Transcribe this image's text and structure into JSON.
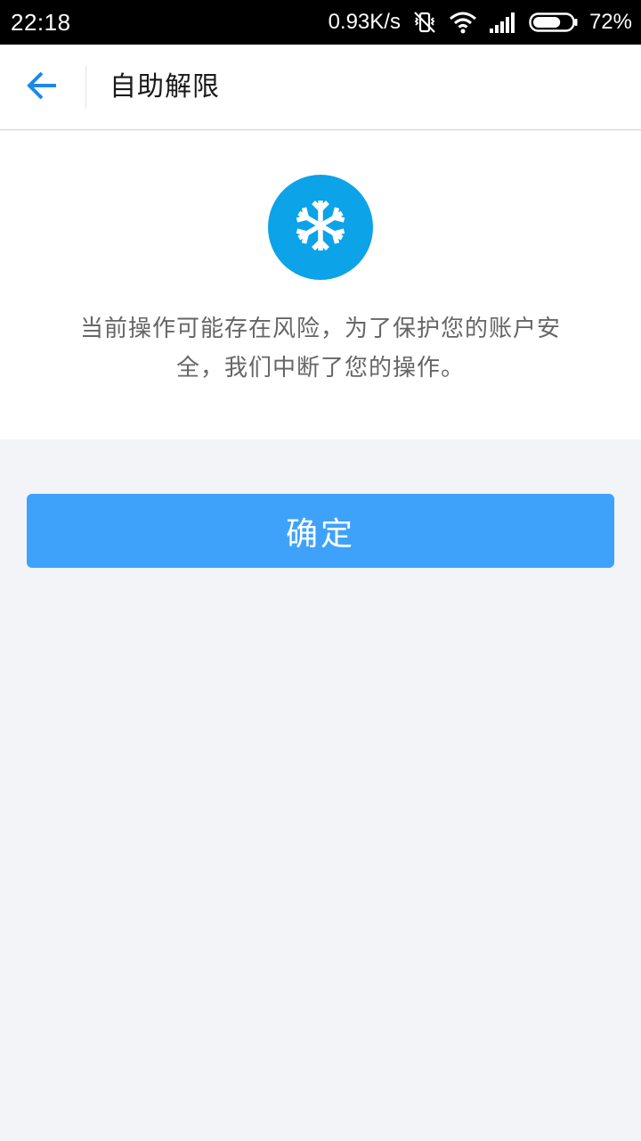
{
  "status_bar": {
    "time": "22:18",
    "network_speed": "0.93K/s",
    "battery_percent": "72%",
    "battery_level": 0.72,
    "icons": [
      "vibrate-off-icon",
      "wifi-icon",
      "signal-icon",
      "battery-icon"
    ]
  },
  "header": {
    "back_icon": "arrow-left-icon",
    "title": "自助解限"
  },
  "notice": {
    "icon": "snowflake-icon",
    "message": "当前操作可能存在风险，为了保护您的账户安全，我们中断了您的操作。"
  },
  "actions": {
    "confirm_label": "确定"
  },
  "colors": {
    "accent": "#0ca3e8",
    "button": "#3ea2fb",
    "back_arrow": "#1e88e5",
    "background": "#f2f4f7"
  }
}
